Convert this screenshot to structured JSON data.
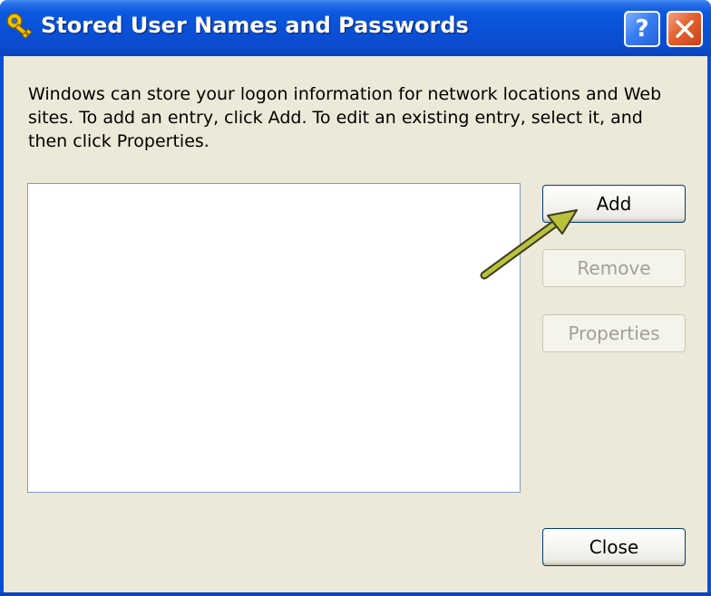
{
  "window": {
    "title": "Stored User Names and Passwords",
    "help_label": "?",
    "title_icon": "key-icon",
    "help_icon": "help-icon",
    "close_icon": "close-icon"
  },
  "dialog": {
    "description": "Windows can store your logon information for network locations and Web sites. To add an entry, click Add. To edit an existing entry, select it, and then click Properties.",
    "credentials_list": []
  },
  "buttons": {
    "add": "Add",
    "remove": "Remove",
    "properties": "Properties",
    "close": "Close"
  },
  "colors": {
    "titlebar": "#0a50d6",
    "dialog_bg": "#ece9d8",
    "annotation_arrow": "#b9c23a"
  }
}
